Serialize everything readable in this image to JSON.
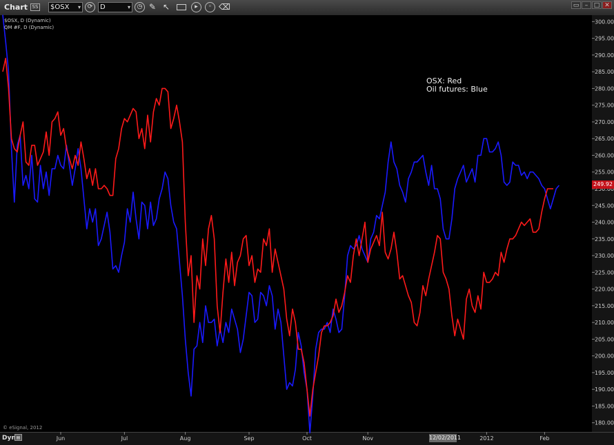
{
  "window": {
    "title": "Chart",
    "badge": "SS",
    "symbol": "$OSX",
    "interval": "D"
  },
  "toolbar_icons": [
    "refresh-icon",
    "clock-icon",
    "pencil-icon",
    "cursor-icon",
    "keyboard-icon",
    "play-icon",
    "zoom-icon",
    "eraser-icon"
  ],
  "window_controls": [
    "restore-icon",
    "minimize-icon",
    "maximize-icon",
    "close-icon"
  ],
  "legend": {
    "line1": "$OSX, D (Dynamic)",
    "line2": "QM #F, D (Dynamic)"
  },
  "annotation": {
    "line1": "OSX:  Red",
    "line2": "Oil futures:  Blue"
  },
  "copyright": "© eSignal, 2012",
  "bottom": {
    "mode": "Dyn",
    "crosshair_date": "12/02/2011"
  },
  "last_value_label": "249.92",
  "colors": {
    "osx": "#ff1a1a",
    "oil": "#1a1aff",
    "background": "#000000",
    "last_value_bg": "#c4121a"
  },
  "chart_data": {
    "type": "line",
    "ylim": [
      176,
      301
    ],
    "yticks": [
      180,
      185,
      190,
      195,
      200,
      205,
      210,
      215,
      220,
      225,
      230,
      235,
      240,
      245,
      250,
      255,
      260,
      265,
      270,
      275,
      280,
      285,
      290,
      295,
      300
    ],
    "xticks": [
      {
        "label": "Jun",
        "bar": 20
      },
      {
        "label": "Jul",
        "bar": 42
      },
      {
        "label": "Aug",
        "bar": 63
      },
      {
        "label": "Sep",
        "bar": 85
      },
      {
        "label": "Oct",
        "bar": 105
      },
      {
        "label": "Nov",
        "bar": 126
      },
      {
        "label": "2012",
        "bar": 167
      },
      {
        "label": "Feb",
        "bar": 187
      }
    ],
    "series": [
      {
        "key": "osx",
        "values": [
          285,
          289,
          280,
          265,
          262,
          261,
          266,
          270,
          258,
          257,
          263,
          263,
          257,
          259,
          261,
          267,
          260,
          270,
          271,
          273,
          266,
          268,
          262,
          259,
          256,
          260,
          257,
          264,
          259,
          253,
          256,
          251,
          256,
          250,
          250,
          251,
          250,
          248,
          248,
          259,
          262,
          268,
          271,
          270,
          272,
          274,
          273,
          265,
          268,
          262,
          272,
          264,
          273,
          277,
          275,
          280,
          280,
          279,
          268,
          271,
          275,
          270,
          264,
          240,
          224,
          230,
          210,
          224,
          220,
          235,
          227,
          238,
          242,
          235,
          215,
          207,
          219,
          229,
          222,
          231,
          221,
          228,
          230,
          235,
          236,
          227,
          230,
          222,
          226,
          225,
          235,
          233,
          238,
          225,
          232,
          228,
          224,
          220,
          211,
          206,
          214,
          210,
          202,
          202,
          198,
          190,
          182,
          190,
          195,
          200,
          207,
          209,
          209,
          210,
          212,
          217,
          213,
          215,
          219,
          224,
          222,
          230,
          235,
          230,
          235,
          240,
          228,
          232,
          234,
          236,
          233,
          243,
          231,
          229,
          232,
          237,
          231,
          223,
          224,
          221,
          218,
          216,
          210,
          209,
          213,
          221,
          218,
          223,
          227,
          231,
          236,
          235,
          225,
          223,
          220,
          212,
          206,
          211,
          208,
          205,
          217,
          220,
          215,
          213,
          218,
          214,
          225,
          222,
          222,
          223,
          225,
          224,
          231,
          228,
          232,
          235,
          235,
          236,
          238,
          240,
          239,
          240,
          241,
          237,
          237,
          238,
          243,
          247,
          250,
          250,
          250
        ]
      },
      {
        "key": "oil",
        "values": [
          302,
          294,
          285,
          262,
          246,
          263,
          266,
          251,
          254,
          250,
          260,
          247,
          246,
          257,
          250,
          255,
          248,
          256,
          256,
          260,
          257,
          256,
          263,
          257,
          251,
          256,
          262,
          256,
          247,
          238,
          244,
          240,
          244,
          233,
          235,
          239,
          243,
          237,
          226,
          227,
          225,
          230,
          234,
          244,
          240,
          249,
          241,
          235,
          246,
          245,
          238,
          246,
          239,
          241,
          247,
          250,
          255,
          253,
          245,
          240,
          238,
          228,
          218,
          205,
          195,
          188,
          202,
          203,
          210,
          204,
          215,
          210,
          210,
          211,
          203,
          208,
          204,
          210,
          207,
          214,
          211,
          208,
          201,
          205,
          212,
          219,
          218,
          210,
          211,
          219,
          218,
          215,
          221,
          218,
          208,
          214,
          210,
          200,
          190,
          192,
          191,
          196,
          207,
          203,
          195,
          190,
          177,
          188,
          202,
          207,
          208,
          208,
          210,
          207,
          214,
          211,
          207,
          208,
          218,
          230,
          233,
          232,
          233,
          236,
          232,
          230,
          228,
          235,
          237,
          242,
          241,
          245,
          249,
          258,
          264,
          258,
          256,
          251,
          249,
          246,
          253,
          255,
          258,
          258,
          259,
          260,
          255,
          251,
          257,
          250,
          250,
          247,
          238,
          235,
          235,
          241,
          250,
          253,
          255,
          257,
          252,
          254,
          256,
          252,
          260,
          260,
          265,
          265,
          261,
          261,
          262,
          264,
          260,
          252,
          251,
          252,
          258,
          257,
          257,
          254,
          255,
          253,
          255,
          255,
          254,
          253,
          251,
          250,
          247,
          244,
          247,
          250,
          251
        ]
      }
    ]
  }
}
